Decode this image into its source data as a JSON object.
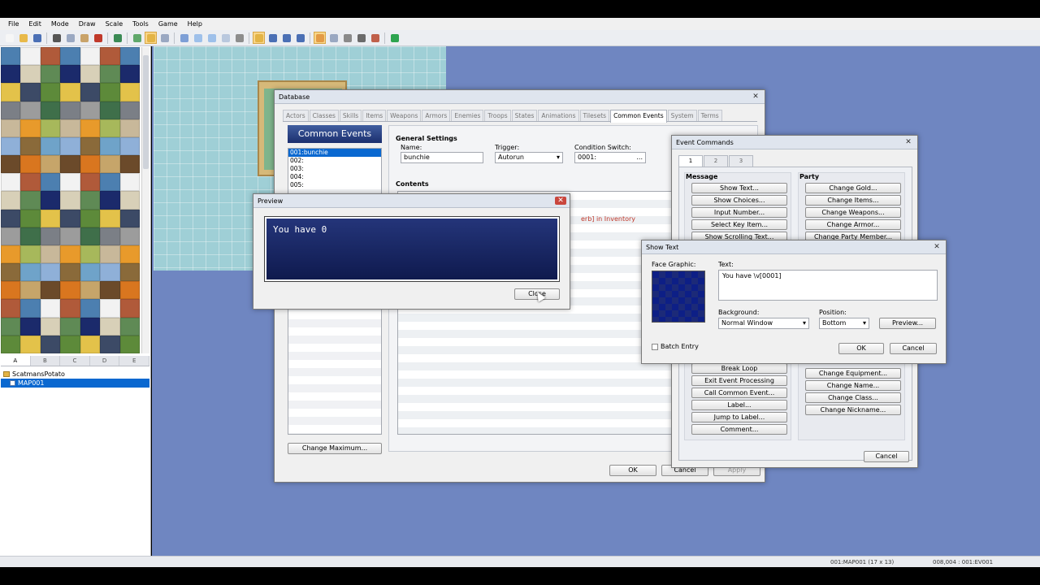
{
  "menu": [
    "File",
    "Edit",
    "Mode",
    "Draw",
    "Scale",
    "Tools",
    "Game",
    "Help"
  ],
  "toolbar_icons": [
    {
      "name": "new-project-icon",
      "c": "#f6f6f6"
    },
    {
      "name": "open-project-icon",
      "c": "#e8b94a"
    },
    {
      "name": "save-project-icon",
      "c": "#4a6fb5"
    },
    {
      "name": "cut-icon",
      "c": "#555"
    },
    {
      "name": "copy-icon",
      "c": "#9aa8c2"
    },
    {
      "name": "paste-icon",
      "c": "#c9a36a"
    },
    {
      "name": "delete-icon",
      "c": "#c0392b"
    },
    {
      "name": "undo-icon",
      "c": "#3a8a55"
    },
    {
      "name": "map-layer-icon",
      "c": "#5fa86b"
    },
    {
      "name": "event-layer-icon",
      "c": "#e3b446"
    },
    {
      "name": "region-layer-icon",
      "c": "#9aa8c2"
    },
    {
      "name": "pencil-icon",
      "c": "#7d9fd6"
    },
    {
      "name": "rectangle-icon",
      "c": "#9ec0ea"
    },
    {
      "name": "ellipse-icon",
      "c": "#9ec0ea"
    },
    {
      "name": "fill-icon",
      "c": "#b9c8de"
    },
    {
      "name": "shadow-pen-icon",
      "c": "#8d8d8d"
    },
    {
      "name": "zoom-1-icon",
      "c": "#e3b446"
    },
    {
      "name": "zoom-2-icon",
      "c": "#4a6fb5"
    },
    {
      "name": "zoom-3-icon",
      "c": "#4a6fb5"
    },
    {
      "name": "zoom-4-icon",
      "c": "#4a6fb5"
    },
    {
      "name": "database-icon",
      "c": "#e39b46"
    },
    {
      "name": "plugin-icon",
      "c": "#9aa8c2"
    },
    {
      "name": "sound-test-icon",
      "c": "#8a8a8a"
    },
    {
      "name": "event-searcher-icon",
      "c": "#6b6b6b"
    },
    {
      "name": "resource-manager-icon",
      "c": "#c0604b"
    },
    {
      "name": "playtest-icon",
      "c": "#2ea44f"
    }
  ],
  "tile_tabs": [
    "A",
    "B",
    "C",
    "D",
    "E"
  ],
  "map_tree": {
    "project": "ScatmansPotato",
    "map": "MAP001"
  },
  "status": {
    "map": "001:MAP001 (17 x 13)",
    "coords": "008,004 : 001:EV001"
  },
  "database": {
    "title": "Database",
    "tabs": [
      "Actors",
      "Classes",
      "Skills",
      "Items",
      "Weapons",
      "Armors",
      "Enemies",
      "Troops",
      "States",
      "Animations",
      "Tilesets",
      "Common Events",
      "System",
      "Terms"
    ],
    "active_tab": "Common Events",
    "list_header": "Common Events",
    "list": [
      "001:bunchie",
      "002:",
      "003:",
      "004:",
      "005:"
    ],
    "general_settings": "General Settings",
    "name_label": "Name:",
    "name_value": "bunchie",
    "trigger_label": "Trigger:",
    "trigger_value": "Autorun",
    "switch_label": "Condition Switch:",
    "switch_value": "0001:",
    "switch_btn": "...",
    "contents_label": "Contents",
    "contents_line": "erb] in Inventory",
    "change_max": "Change Maximum...",
    "ok": "OK",
    "cancel": "Cancel",
    "apply": "Apply"
  },
  "preview": {
    "title": "Preview",
    "message": "You have 0",
    "close": "Close"
  },
  "event_commands": {
    "title": "Event Commands",
    "tabs": [
      "1",
      "2",
      "3"
    ],
    "message_group": "Message",
    "party_group": "Party",
    "message_buttons": [
      "Show Text...",
      "Show Choices...",
      "Input Number...",
      "Select Key Item...",
      "Show Scrolling Text..."
    ],
    "party_buttons": [
      "Change Gold...",
      "Change Items...",
      "Change Weapons...",
      "Change Armor...",
      "Change Party Member..."
    ],
    "lower_left_buttons": [
      "Break Loop",
      "Exit Event Processing",
      "Call Common Event...",
      "Label...",
      "Jump to Label...",
      "Comment..."
    ],
    "lower_right_buttons": [
      "Change Equipment...",
      "Change Name...",
      "Change Class...",
      "Change Nickname..."
    ],
    "cancel": "Cancel"
  },
  "show_text": {
    "title": "Show Text",
    "face_label": "Face Graphic:",
    "text_label": "Text:",
    "text_value": "You have \\v[0001]",
    "background_label": "Background:",
    "background_value": "Normal Window",
    "position_label": "Position:",
    "position_value": "Bottom",
    "preview_btn": "Preview...",
    "batch_label": "Batch Entry",
    "ok": "OK",
    "cancel": "Cancel"
  }
}
